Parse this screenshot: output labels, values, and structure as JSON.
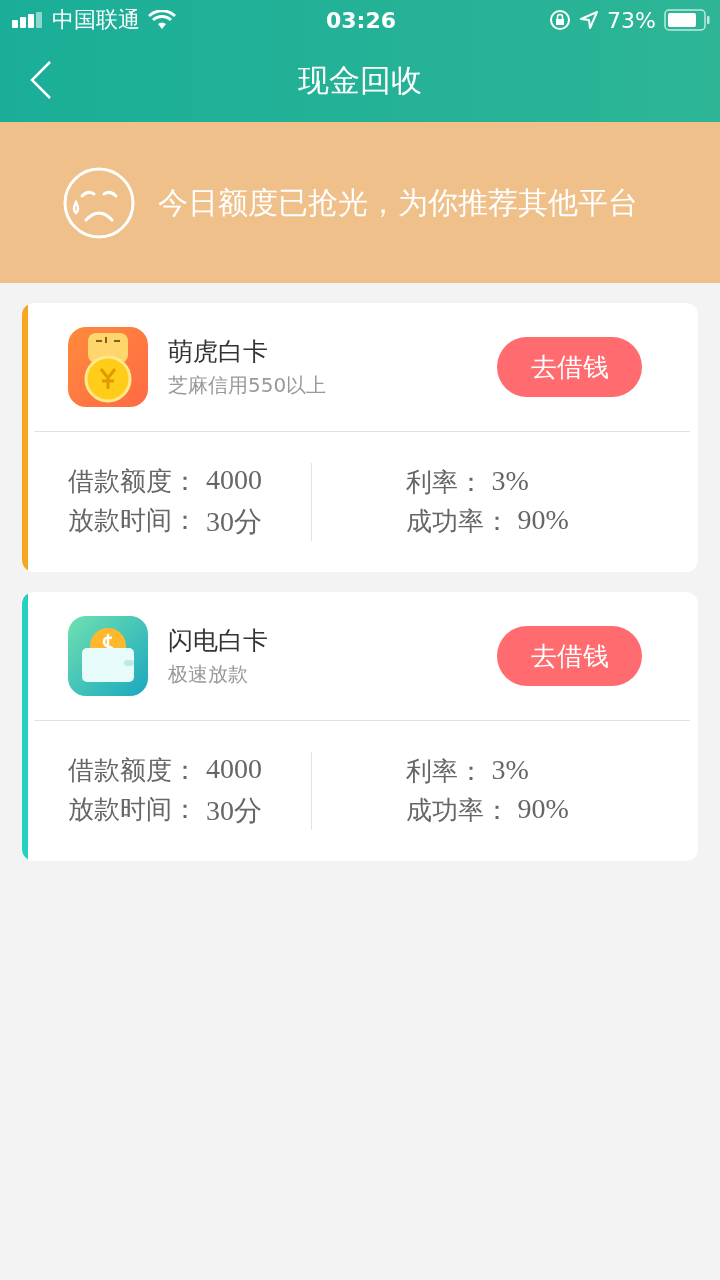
{
  "status_bar": {
    "carrier": "中国联通",
    "time": "03:26",
    "battery": "73%"
  },
  "nav": {
    "title": "现金回收"
  },
  "banner": {
    "message": "今日额度已抢光，为你推荐其他平台"
  },
  "cards": [
    {
      "kind": "tiger",
      "color": "#f5a623",
      "name": "萌虎白卡",
      "subtitle": "芝麻信用550以上",
      "button": "去借钱",
      "left": [
        {
          "label": "借款额度：",
          "value": "4000"
        },
        {
          "label": "放款时间：",
          "value": "30分"
        }
      ],
      "right": [
        {
          "label": "利率：",
          "value": "3%"
        },
        {
          "label": "成功率：",
          "value": "90%"
        }
      ]
    },
    {
      "kind": "wallet",
      "color": "#26d0c0",
      "name": "闪电白卡",
      "subtitle": "极速放款",
      "button": "去借钱",
      "left": [
        {
          "label": "借款额度：",
          "value": "4000"
        },
        {
          "label": "放款时间：",
          "value": "30分"
        }
      ],
      "right": [
        {
          "label": "利率：",
          "value": "3%"
        },
        {
          "label": "成功率：",
          "value": "90%"
        }
      ]
    }
  ]
}
